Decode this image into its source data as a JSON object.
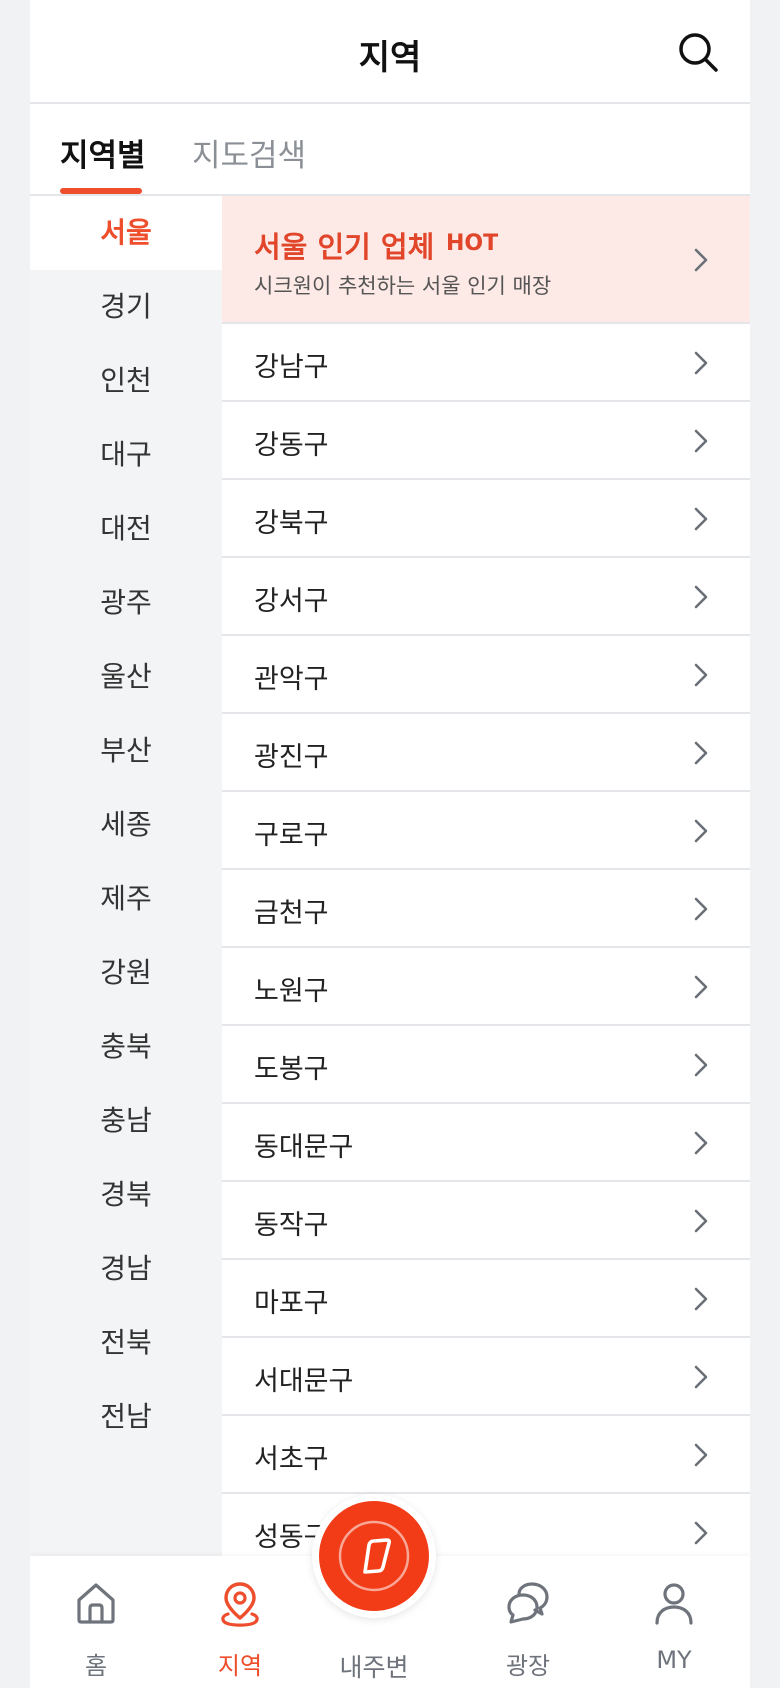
{
  "header": {
    "title": "지역"
  },
  "tabs": [
    {
      "label": "지역별",
      "active": true
    },
    {
      "label": "지도검색",
      "active": false
    }
  ],
  "regions": [
    {
      "label": "서울",
      "active": true
    },
    {
      "label": "경기"
    },
    {
      "label": "인천"
    },
    {
      "label": "대구"
    },
    {
      "label": "대전"
    },
    {
      "label": "광주"
    },
    {
      "label": "울산"
    },
    {
      "label": "부산"
    },
    {
      "label": "세종"
    },
    {
      "label": "제주"
    },
    {
      "label": "강원"
    },
    {
      "label": "충북"
    },
    {
      "label": "충남"
    },
    {
      "label": "경북"
    },
    {
      "label": "경남"
    },
    {
      "label": "전북"
    },
    {
      "label": "전남"
    }
  ],
  "hot": {
    "title": "서울 인기 업체",
    "badge": "HOT",
    "subtitle": "시크원이 추천하는 서울 인기 매장"
  },
  "districts": [
    "강남구",
    "강동구",
    "강북구",
    "강서구",
    "관악구",
    "광진구",
    "구로구",
    "금천구",
    "노원구",
    "도봉구",
    "동대문구",
    "동작구",
    "마포구",
    "서대문구",
    "서초구",
    "성동구"
  ],
  "nav": {
    "home": "홈",
    "region": "지역",
    "nearby": "내주변",
    "plaza": "광장",
    "my": "MY"
  },
  "colors": {
    "accent": "#ee4e2c",
    "hot_bg": "#fde9e5",
    "sidebar_bg": "#f3f4f6",
    "divider": "#e4e6ea"
  }
}
